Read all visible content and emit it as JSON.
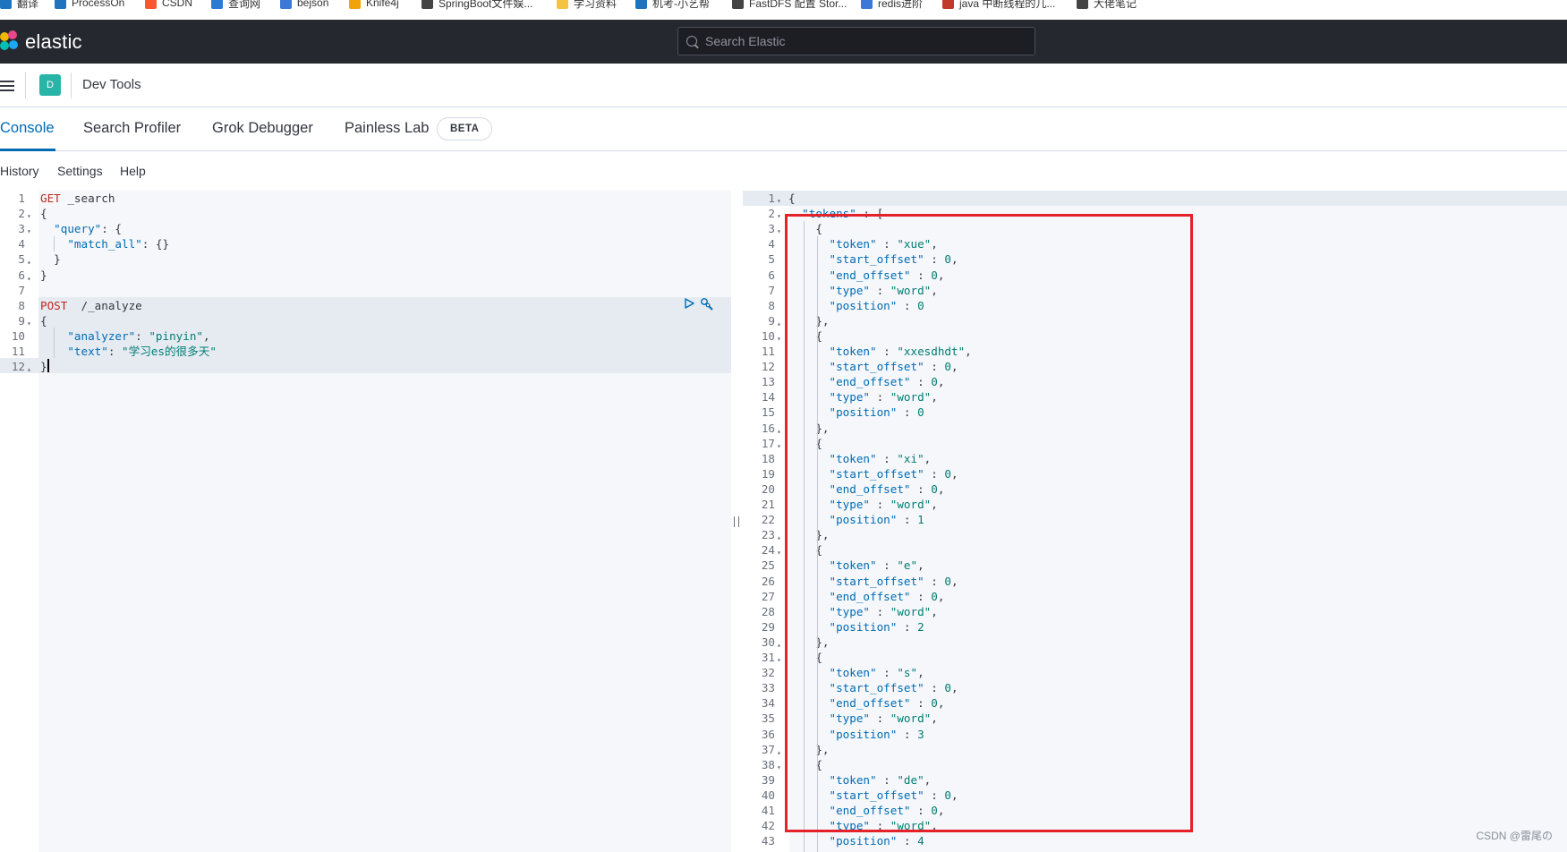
{
  "bookmarks": [
    {
      "label": "翻译",
      "color": "#1e73be"
    },
    {
      "label": "ProcessOn",
      "color": "#1e73be"
    },
    {
      "label": "CSDN",
      "color": "#fc5531"
    },
    {
      "label": "查询网",
      "color": "#2b7bd6"
    },
    {
      "label": "bejson",
      "color": "#3c78d8"
    },
    {
      "label": "Knife4j",
      "color": "#f0a30a"
    },
    {
      "label": "SpringBoot文件娱...",
      "color": "#444444"
    },
    {
      "label": "学习资料",
      "color": "#f5c342"
    },
    {
      "label": "机考-小艺帮",
      "color": "#1e73be"
    },
    {
      "label": "FastDFS 配置 Stor...",
      "color": "#444444"
    },
    {
      "label": "redis进阶",
      "color": "#3c78d8"
    },
    {
      "label": "java 中断线程的几...",
      "color": "#c0392b"
    },
    {
      "label": "大佬笔记",
      "color": "#444444"
    }
  ],
  "header": {
    "logo_text": "elastic",
    "search_placeholder": "Search Elastic"
  },
  "breadcrumb": {
    "avatar_letter": "D",
    "title": "Dev Tools"
  },
  "tabs": [
    {
      "label": "Console",
      "active": true
    },
    {
      "label": "Search Profiler",
      "active": false
    },
    {
      "label": "Grok Debugger",
      "active": false
    },
    {
      "label": "Painless Lab",
      "active": false
    }
  ],
  "beta_badge": "BETA",
  "subnav": {
    "history": "History",
    "settings": "Settings",
    "help": "Help"
  },
  "request_lines": [
    {
      "n": "1",
      "fold": "",
      "parts": [
        {
          "c": "m",
          "t": "GET"
        },
        {
          "c": "p",
          "t": " _search"
        }
      ]
    },
    {
      "n": "2",
      "fold": "▾",
      "parts": [
        {
          "c": "p",
          "t": "{"
        }
      ]
    },
    {
      "n": "3",
      "fold": "▾",
      "parts": [
        {
          "c": "p",
          "t": "  "
        },
        {
          "c": "k",
          "t": "\"query\""
        },
        {
          "c": "p",
          "t": ": {"
        }
      ]
    },
    {
      "n": "4",
      "fold": "",
      "parts": [
        {
          "c": "p",
          "t": "    "
        },
        {
          "c": "k",
          "t": "\"match_all\""
        },
        {
          "c": "p",
          "t": ": {}"
        }
      ]
    },
    {
      "n": "5",
      "fold": "▴",
      "parts": [
        {
          "c": "p",
          "t": "  }"
        }
      ]
    },
    {
      "n": "6",
      "fold": "▴",
      "parts": [
        {
          "c": "p",
          "t": "}"
        }
      ]
    },
    {
      "n": "7",
      "fold": "",
      "parts": []
    },
    {
      "n": "8",
      "fold": "",
      "parts": [
        {
          "c": "m",
          "t": "POST"
        },
        {
          "c": "p",
          "t": "  /_analyze"
        }
      ]
    },
    {
      "n": "9",
      "fold": "▾",
      "parts": [
        {
          "c": "p",
          "t": "{"
        }
      ]
    },
    {
      "n": "10",
      "fold": "",
      "parts": [
        {
          "c": "p",
          "t": "    "
        },
        {
          "c": "k",
          "t": "\"analyzer\""
        },
        {
          "c": "p",
          "t": ": "
        },
        {
          "c": "s",
          "t": "\"pinyin\""
        },
        {
          "c": "p",
          "t": ","
        }
      ]
    },
    {
      "n": "11",
      "fold": "",
      "parts": [
        {
          "c": "p",
          "t": "    "
        },
        {
          "c": "k",
          "t": "\"text\""
        },
        {
          "c": "p",
          "t": ": "
        },
        {
          "c": "s",
          "t": "\"学习es的很多天\""
        }
      ]
    },
    {
      "n": "12",
      "fold": "▴",
      "parts": [
        {
          "c": "p",
          "t": "}"
        }
      ]
    }
  ],
  "response_lines": [
    {
      "n": "1",
      "fold": "▾",
      "parts": [
        {
          "c": "p",
          "t": "{"
        }
      ]
    },
    {
      "n": "2",
      "fold": "▾",
      "parts": [
        {
          "c": "p",
          "t": "  "
        },
        {
          "c": "k",
          "t": "\"tokens\""
        },
        {
          "c": "p",
          "t": " : ["
        }
      ]
    },
    {
      "n": "3",
      "fold": "▾",
      "parts": [
        {
          "c": "p",
          "t": "    {"
        }
      ]
    },
    {
      "n": "4",
      "fold": "",
      "parts": [
        {
          "c": "p",
          "t": "      "
        },
        {
          "c": "k",
          "t": "\"token\""
        },
        {
          "c": "p",
          "t": " : "
        },
        {
          "c": "s",
          "t": "\"xue\""
        },
        {
          "c": "p",
          "t": ","
        }
      ]
    },
    {
      "n": "5",
      "fold": "",
      "parts": [
        {
          "c": "p",
          "t": "      "
        },
        {
          "c": "k",
          "t": "\"start_offset\""
        },
        {
          "c": "p",
          "t": " : "
        },
        {
          "c": "n",
          "t": "0"
        },
        {
          "c": "p",
          "t": ","
        }
      ]
    },
    {
      "n": "6",
      "fold": "",
      "parts": [
        {
          "c": "p",
          "t": "      "
        },
        {
          "c": "k",
          "t": "\"end_offset\""
        },
        {
          "c": "p",
          "t": " : "
        },
        {
          "c": "n",
          "t": "0"
        },
        {
          "c": "p",
          "t": ","
        }
      ]
    },
    {
      "n": "7",
      "fold": "",
      "parts": [
        {
          "c": "p",
          "t": "      "
        },
        {
          "c": "k",
          "t": "\"type\""
        },
        {
          "c": "p",
          "t": " : "
        },
        {
          "c": "s",
          "t": "\"word\""
        },
        {
          "c": "p",
          "t": ","
        }
      ]
    },
    {
      "n": "8",
      "fold": "",
      "parts": [
        {
          "c": "p",
          "t": "      "
        },
        {
          "c": "k",
          "t": "\"position\""
        },
        {
          "c": "p",
          "t": " : "
        },
        {
          "c": "n",
          "t": "0"
        }
      ]
    },
    {
      "n": "9",
      "fold": "▴",
      "parts": [
        {
          "c": "p",
          "t": "    },"
        }
      ]
    },
    {
      "n": "10",
      "fold": "▾",
      "parts": [
        {
          "c": "p",
          "t": "    {"
        }
      ]
    },
    {
      "n": "11",
      "fold": "",
      "parts": [
        {
          "c": "p",
          "t": "      "
        },
        {
          "c": "k",
          "t": "\"token\""
        },
        {
          "c": "p",
          "t": " : "
        },
        {
          "c": "s",
          "t": "\"xxesdhdt\""
        },
        {
          "c": "p",
          "t": ","
        }
      ]
    },
    {
      "n": "12",
      "fold": "",
      "parts": [
        {
          "c": "p",
          "t": "      "
        },
        {
          "c": "k",
          "t": "\"start_offset\""
        },
        {
          "c": "p",
          "t": " : "
        },
        {
          "c": "n",
          "t": "0"
        },
        {
          "c": "p",
          "t": ","
        }
      ]
    },
    {
      "n": "13",
      "fold": "",
      "parts": [
        {
          "c": "p",
          "t": "      "
        },
        {
          "c": "k",
          "t": "\"end_offset\""
        },
        {
          "c": "p",
          "t": " : "
        },
        {
          "c": "n",
          "t": "0"
        },
        {
          "c": "p",
          "t": ","
        }
      ]
    },
    {
      "n": "14",
      "fold": "",
      "parts": [
        {
          "c": "p",
          "t": "      "
        },
        {
          "c": "k",
          "t": "\"type\""
        },
        {
          "c": "p",
          "t": " : "
        },
        {
          "c": "s",
          "t": "\"word\""
        },
        {
          "c": "p",
          "t": ","
        }
      ]
    },
    {
      "n": "15",
      "fold": "",
      "parts": [
        {
          "c": "p",
          "t": "      "
        },
        {
          "c": "k",
          "t": "\"position\""
        },
        {
          "c": "p",
          "t": " : "
        },
        {
          "c": "n",
          "t": "0"
        }
      ]
    },
    {
      "n": "16",
      "fold": "▴",
      "parts": [
        {
          "c": "p",
          "t": "    },"
        }
      ]
    },
    {
      "n": "17",
      "fold": "▾",
      "parts": [
        {
          "c": "p",
          "t": "    {"
        }
      ]
    },
    {
      "n": "18",
      "fold": "",
      "parts": [
        {
          "c": "p",
          "t": "      "
        },
        {
          "c": "k",
          "t": "\"token\""
        },
        {
          "c": "p",
          "t": " : "
        },
        {
          "c": "s",
          "t": "\"xi\""
        },
        {
          "c": "p",
          "t": ","
        }
      ]
    },
    {
      "n": "19",
      "fold": "",
      "parts": [
        {
          "c": "p",
          "t": "      "
        },
        {
          "c": "k",
          "t": "\"start_offset\""
        },
        {
          "c": "p",
          "t": " : "
        },
        {
          "c": "n",
          "t": "0"
        },
        {
          "c": "p",
          "t": ","
        }
      ]
    },
    {
      "n": "20",
      "fold": "",
      "parts": [
        {
          "c": "p",
          "t": "      "
        },
        {
          "c": "k",
          "t": "\"end_offset\""
        },
        {
          "c": "p",
          "t": " : "
        },
        {
          "c": "n",
          "t": "0"
        },
        {
          "c": "p",
          "t": ","
        }
      ]
    },
    {
      "n": "21",
      "fold": "",
      "parts": [
        {
          "c": "p",
          "t": "      "
        },
        {
          "c": "k",
          "t": "\"type\""
        },
        {
          "c": "p",
          "t": " : "
        },
        {
          "c": "s",
          "t": "\"word\""
        },
        {
          "c": "p",
          "t": ","
        }
      ]
    },
    {
      "n": "22",
      "fold": "",
      "parts": [
        {
          "c": "p",
          "t": "      "
        },
        {
          "c": "k",
          "t": "\"position\""
        },
        {
          "c": "p",
          "t": " : "
        },
        {
          "c": "n",
          "t": "1"
        }
      ]
    },
    {
      "n": "23",
      "fold": "▴",
      "parts": [
        {
          "c": "p",
          "t": "    },"
        }
      ]
    },
    {
      "n": "24",
      "fold": "▾",
      "parts": [
        {
          "c": "p",
          "t": "    {"
        }
      ]
    },
    {
      "n": "25",
      "fold": "",
      "parts": [
        {
          "c": "p",
          "t": "      "
        },
        {
          "c": "k",
          "t": "\"token\""
        },
        {
          "c": "p",
          "t": " : "
        },
        {
          "c": "s",
          "t": "\"e\""
        },
        {
          "c": "p",
          "t": ","
        }
      ]
    },
    {
      "n": "26",
      "fold": "",
      "parts": [
        {
          "c": "p",
          "t": "      "
        },
        {
          "c": "k",
          "t": "\"start_offset\""
        },
        {
          "c": "p",
          "t": " : "
        },
        {
          "c": "n",
          "t": "0"
        },
        {
          "c": "p",
          "t": ","
        }
      ]
    },
    {
      "n": "27",
      "fold": "",
      "parts": [
        {
          "c": "p",
          "t": "      "
        },
        {
          "c": "k",
          "t": "\"end_offset\""
        },
        {
          "c": "p",
          "t": " : "
        },
        {
          "c": "n",
          "t": "0"
        },
        {
          "c": "p",
          "t": ","
        }
      ]
    },
    {
      "n": "28",
      "fold": "",
      "parts": [
        {
          "c": "p",
          "t": "      "
        },
        {
          "c": "k",
          "t": "\"type\""
        },
        {
          "c": "p",
          "t": " : "
        },
        {
          "c": "s",
          "t": "\"word\""
        },
        {
          "c": "p",
          "t": ","
        }
      ]
    },
    {
      "n": "29",
      "fold": "",
      "parts": [
        {
          "c": "p",
          "t": "      "
        },
        {
          "c": "k",
          "t": "\"position\""
        },
        {
          "c": "p",
          "t": " : "
        },
        {
          "c": "n",
          "t": "2"
        }
      ]
    },
    {
      "n": "30",
      "fold": "▴",
      "parts": [
        {
          "c": "p",
          "t": "    },"
        }
      ]
    },
    {
      "n": "31",
      "fold": "▾",
      "parts": [
        {
          "c": "p",
          "t": "    {"
        }
      ]
    },
    {
      "n": "32",
      "fold": "",
      "parts": [
        {
          "c": "p",
          "t": "      "
        },
        {
          "c": "k",
          "t": "\"token\""
        },
        {
          "c": "p",
          "t": " : "
        },
        {
          "c": "s",
          "t": "\"s\""
        },
        {
          "c": "p",
          "t": ","
        }
      ]
    },
    {
      "n": "33",
      "fold": "",
      "parts": [
        {
          "c": "p",
          "t": "      "
        },
        {
          "c": "k",
          "t": "\"start_offset\""
        },
        {
          "c": "p",
          "t": " : "
        },
        {
          "c": "n",
          "t": "0"
        },
        {
          "c": "p",
          "t": ","
        }
      ]
    },
    {
      "n": "34",
      "fold": "",
      "parts": [
        {
          "c": "p",
          "t": "      "
        },
        {
          "c": "k",
          "t": "\"end_offset\""
        },
        {
          "c": "p",
          "t": " : "
        },
        {
          "c": "n",
          "t": "0"
        },
        {
          "c": "p",
          "t": ","
        }
      ]
    },
    {
      "n": "35",
      "fold": "",
      "parts": [
        {
          "c": "p",
          "t": "      "
        },
        {
          "c": "k",
          "t": "\"type\""
        },
        {
          "c": "p",
          "t": " : "
        },
        {
          "c": "s",
          "t": "\"word\""
        },
        {
          "c": "p",
          "t": ","
        }
      ]
    },
    {
      "n": "36",
      "fold": "",
      "parts": [
        {
          "c": "p",
          "t": "      "
        },
        {
          "c": "k",
          "t": "\"position\""
        },
        {
          "c": "p",
          "t": " : "
        },
        {
          "c": "n",
          "t": "3"
        }
      ]
    },
    {
      "n": "37",
      "fold": "▴",
      "parts": [
        {
          "c": "p",
          "t": "    },"
        }
      ]
    },
    {
      "n": "38",
      "fold": "▾",
      "parts": [
        {
          "c": "p",
          "t": "    {"
        }
      ]
    },
    {
      "n": "39",
      "fold": "",
      "parts": [
        {
          "c": "p",
          "t": "      "
        },
        {
          "c": "k",
          "t": "\"token\""
        },
        {
          "c": "p",
          "t": " : "
        },
        {
          "c": "s",
          "t": "\"de\""
        },
        {
          "c": "p",
          "t": ","
        }
      ]
    },
    {
      "n": "40",
      "fold": "",
      "parts": [
        {
          "c": "p",
          "t": "      "
        },
        {
          "c": "k",
          "t": "\"start_offset\""
        },
        {
          "c": "p",
          "t": " : "
        },
        {
          "c": "n",
          "t": "0"
        },
        {
          "c": "p",
          "t": ","
        }
      ]
    },
    {
      "n": "41",
      "fold": "",
      "parts": [
        {
          "c": "p",
          "t": "      "
        },
        {
          "c": "k",
          "t": "\"end_offset\""
        },
        {
          "c": "p",
          "t": " : "
        },
        {
          "c": "n",
          "t": "0"
        },
        {
          "c": "p",
          "t": ","
        }
      ]
    },
    {
      "n": "42",
      "fold": "",
      "parts": [
        {
          "c": "p",
          "t": "      "
        },
        {
          "c": "k",
          "t": "\"type\""
        },
        {
          "c": "p",
          "t": " : "
        },
        {
          "c": "s",
          "t": "\"word\""
        },
        {
          "c": "p",
          "t": ","
        }
      ]
    },
    {
      "n": "43",
      "fold": "",
      "parts": [
        {
          "c": "p",
          "t": "      "
        },
        {
          "c": "k",
          "t": "\"position\""
        },
        {
          "c": "p",
          "t": " : "
        },
        {
          "c": "n",
          "t": "4"
        }
      ]
    }
  ],
  "watermark": "CSDN @雷尾の",
  "colors": {
    "accent": "#006bb4",
    "header_bg": "#25282f",
    "highlight_box": "#e5212a",
    "method": "#bd271e",
    "string": "#017d73"
  }
}
